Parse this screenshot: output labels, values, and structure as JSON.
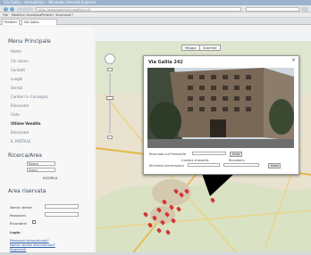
{
  "browser": {
    "window_title": "Via Gallia – Immobiliari – Windows Internet Explorer",
    "url": "http://www.galleriaimmobiliare.it/",
    "menu": [
      "File",
      "Modifica",
      "Visualizza",
      "Preferiti",
      "Strumenti",
      "?"
    ],
    "tabs": [
      "Preferiti",
      "Via Gallia"
    ]
  },
  "sidebar": {
    "menu_title": "Menu Principale",
    "menu_items": [
      "Home",
      "Chi siamo",
      "Contatti",
      "Luoghi",
      "Servizi",
      "Cantieri in Consegna",
      "Rinnovate",
      "Vista",
      "Ultime Vendite",
      "Rinnovate",
      "IL PORTALE"
    ],
    "search_title": "Ricerca/Area",
    "search_fields": [
      "Roma",
      "Zona"
    ],
    "search_button": "RICERCA",
    "login_title": "Area riservata",
    "login_labels": [
      "Nome utente",
      "Password",
      "Ricordami"
    ],
    "login_button": "Login",
    "links": [
      "Password dimenticata?",
      "Nome utente dimenticato?",
      "Registrati"
    ]
  },
  "map": {
    "type_buttons": [
      "Mappa",
      "Satellite"
    ],
    "popup": {
      "title": "Via Gallia 242",
      "close": "×",
      "row1_label": "Riservato sull'immobile",
      "row1_button": "Invia",
      "row2_labels": [
        "Cambia immobile",
        "Ricordami"
      ],
      "row3_label": "Richiesta informazioni",
      "row3_button": "Invia"
    }
  }
}
